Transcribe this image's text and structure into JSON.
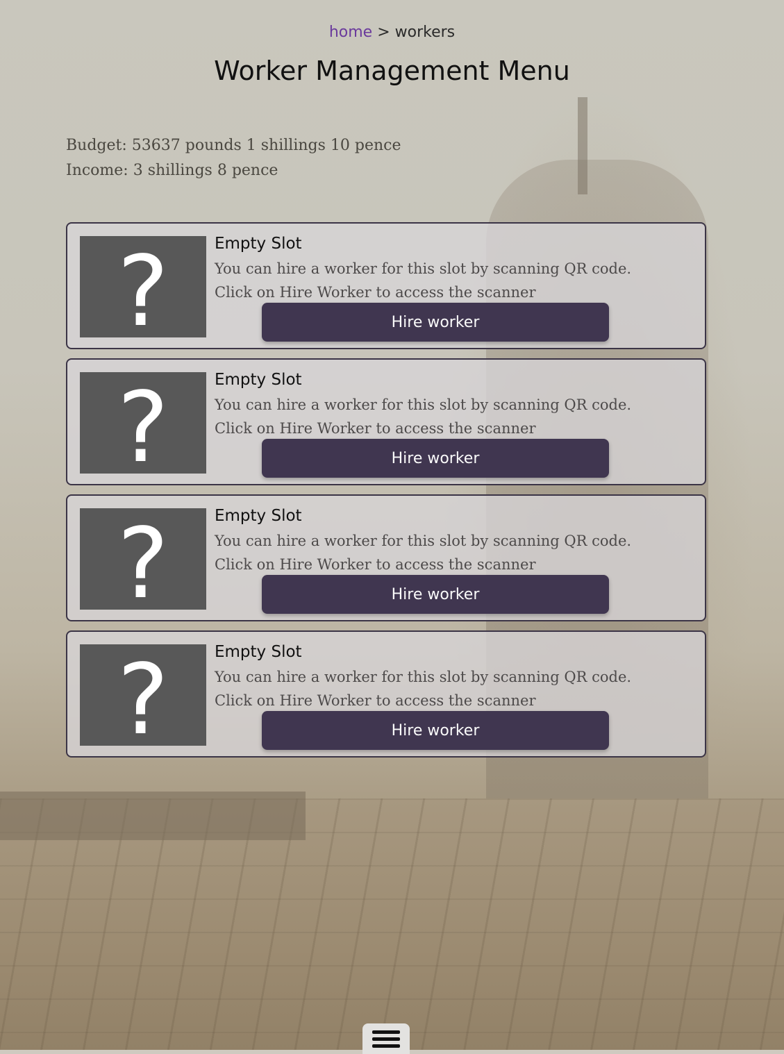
{
  "breadcrumb": {
    "home": "home",
    "separator": " > ",
    "current": "workers"
  },
  "page": {
    "title": "Worker Management Menu"
  },
  "stats": {
    "budget": "Budget: 53637 pounds 1 shillings 10 pence",
    "income": "Income: 3 shillings 8 pence"
  },
  "slots": [
    {
      "title": "Empty Slot",
      "desc_line1": "You can hire a worker for this slot by scanning QR code.",
      "desc_line2": "Click on Hire Worker to access the scanner",
      "button_label": "Hire worker",
      "icon": "question-mark-icon"
    },
    {
      "title": "Empty Slot",
      "desc_line1": "You can hire a worker for this slot by scanning QR code.",
      "desc_line2": "Click on Hire Worker to access the scanner",
      "button_label": "Hire worker",
      "icon": "question-mark-icon"
    },
    {
      "title": "Empty Slot",
      "desc_line1": "You can hire a worker for this slot by scanning QR code.",
      "desc_line2": "Click on Hire Worker to access the scanner",
      "button_label": "Hire worker",
      "icon": "question-mark-icon"
    },
    {
      "title": "Empty Slot",
      "desc_line1": "You can hire a worker for this slot by scanning QR code.",
      "desc_line2": "Click on Hire Worker to access the scanner",
      "button_label": "Hire worker",
      "icon": "question-mark-icon"
    }
  ],
  "menu": {
    "icon": "hamburger-menu-icon"
  },
  "colors": {
    "button_bg": "#403650",
    "slot_border": "#3b3446",
    "placeholder_bg": "#585858",
    "link": "#6a3a9c"
  }
}
